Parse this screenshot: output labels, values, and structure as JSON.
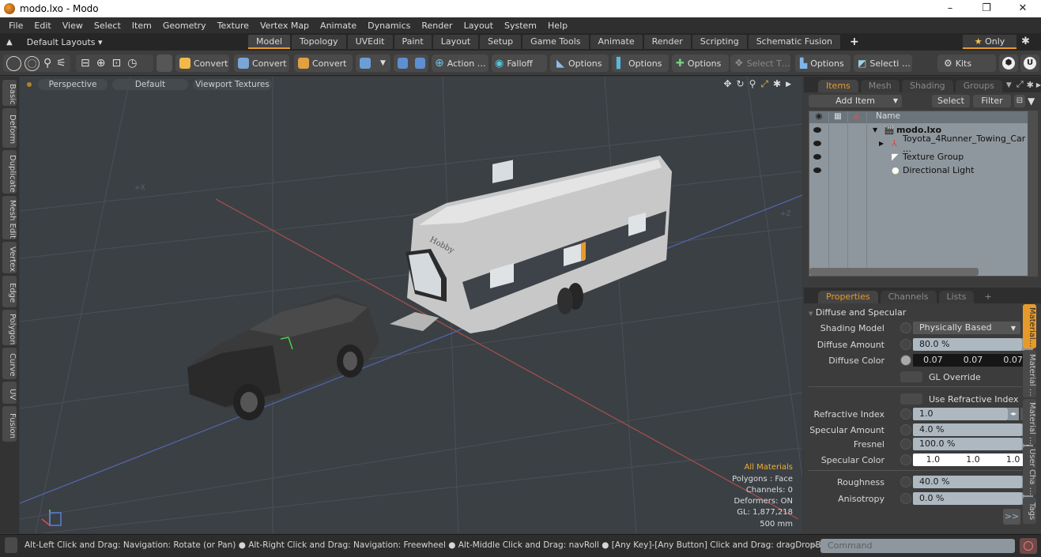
{
  "window": {
    "title": "modo.lxo - Modo",
    "controls": {
      "minimize": "–",
      "restore": "❐",
      "close": "✕"
    }
  },
  "menu": [
    "File",
    "Edit",
    "View",
    "Select",
    "Item",
    "Geometry",
    "Texture",
    "Vertex Map",
    "Animate",
    "Dynamics",
    "Render",
    "Layout",
    "System",
    "Help"
  ],
  "layoutbar": {
    "preset_label": "Default Layouts ▾",
    "tabs": [
      "Model",
      "Topology",
      "UVEdit",
      "Paint",
      "Layout",
      "Setup",
      "Game Tools",
      "Animate",
      "Render",
      "Scripting",
      "Schematic Fusion"
    ],
    "active_tab": "Model",
    "plus": "+",
    "only_label": "Only",
    "only_star": "★"
  },
  "toolbar": {
    "convert1": "Convert",
    "convert2": "Convert",
    "convert3": "Convert",
    "action": "Action …",
    "falloff": "Falloff",
    "options1": "Options",
    "options2": "Options",
    "options3": "Options",
    "select_t": "Select T…",
    "options4": "Options",
    "selecti": "Selecti …",
    "kits": "Kits"
  },
  "left_tabs": [
    "Basic",
    "Deform",
    "Duplicate",
    "Mesh Edit",
    "Vertex",
    "Edge",
    "Polygon",
    "Curve",
    "UV",
    "Fusion"
  ],
  "viewport": {
    "view_mode": "Perspective",
    "shading": "Default",
    "textures": "Viewport Textures",
    "axis_x_label": "+X",
    "axis_z_label": "+Z",
    "trailer_brand": "Hobby",
    "info": {
      "materials": "All Materials",
      "polygons": "Polygons : Face",
      "channels": "Channels: 0",
      "deformers": "Deformers: ON",
      "gl": "GL: 1,877,218",
      "scale": "500 mm"
    }
  },
  "items_panel": {
    "tabs": [
      "Items",
      "Mesh …",
      "Shading",
      "Groups"
    ],
    "active_tab": "Items",
    "add_item": "Add Item",
    "select": "Select",
    "filter": "Filter",
    "column_name": "Name",
    "rows": [
      {
        "name": "modo.lxo",
        "bold": true
      },
      {
        "name": "Toyota_4Runner_Towing_Car …"
      },
      {
        "name": "Texture Group"
      },
      {
        "name": "Directional Light"
      }
    ]
  },
  "properties_panel": {
    "tabs": [
      "Properties",
      "Channels",
      "Lists",
      "+"
    ],
    "active_tab": "Properties",
    "section": "Diffuse and Specular",
    "shading_model": {
      "label": "Shading Model",
      "value": "Physically Based"
    },
    "diffuse_amount": {
      "label": "Diffuse Amount",
      "value": "80.0 %"
    },
    "diffuse_color": {
      "label": "Diffuse Color",
      "r": "0.07",
      "g": "0.07",
      "b": "0.07"
    },
    "gl_override": "GL Override",
    "use_refractive": "Use Refractive Index",
    "refractive_index": {
      "label": "Refractive Index",
      "value": "1.0"
    },
    "specular_amount": {
      "label": "Specular Amount",
      "value": "4.0 %"
    },
    "fresnel": {
      "label": "Fresnel",
      "value": "100.0 %"
    },
    "specular_color": {
      "label": "Specular Color",
      "r": "1.0",
      "g": "1.0",
      "b": "1.0"
    },
    "roughness": {
      "label": "Roughness",
      "value": "40.0 %"
    },
    "anisotropy": {
      "label": "Anisotropy",
      "value": "0.0 %"
    },
    "more": ">>",
    "side_tabs": [
      "Material…",
      "Material …",
      "Material …",
      "User Cha …",
      "Tags"
    ]
  },
  "statusbar": {
    "message": "Alt-Left Click and Drag: Navigation: Rotate (or Pan) ● Alt-Right Click and Drag: Navigation: Freewheel ● Alt-Middle Click and Drag: navRoll ● [Any Key]-[Any Button] Click and Drag: dragDropBegin",
    "prompt": ">",
    "command_placeholder": "Command"
  },
  "colors": {
    "accent": "#e69a2c",
    "viewport_bg": "#3b4045",
    "tree_bg": "#8f979e"
  }
}
